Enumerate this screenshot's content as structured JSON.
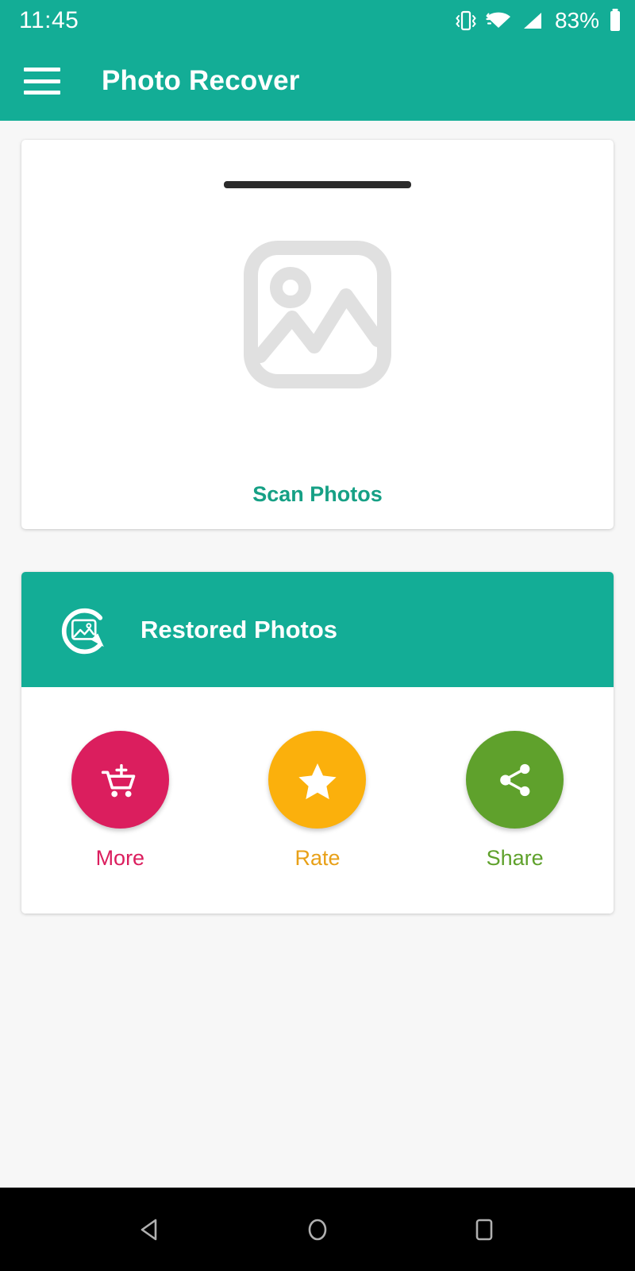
{
  "statusbar": {
    "time": "11:45",
    "battery_percent": "83%",
    "icons": [
      "vibrate-icon",
      "wifi-icon",
      "signal-icon",
      "battery-icon"
    ]
  },
  "appbar": {
    "menu_icon": "hamburger-menu-icon",
    "title": "Photo Recover",
    "background_color": "#13ad96"
  },
  "scan_card": {
    "illustration_icon": "image-placeholder-icon",
    "scan_line_color": "#2b2b2b",
    "label": "Scan Photos",
    "label_color": "#16a085"
  },
  "restored_card": {
    "header": {
      "icon": "restore-photo-icon",
      "title": "Restored Photos",
      "background_color": "#13ad96"
    },
    "actions": [
      {
        "label": "More",
        "icon": "cart-plus-icon",
        "color": "#db1e5e"
      },
      {
        "label": "Rate",
        "icon": "star-icon",
        "color": "#fbb00c"
      },
      {
        "label": "Share",
        "icon": "share-icon",
        "color": "#5fa12c"
      }
    ]
  },
  "navbar": {
    "back_label": "back-icon",
    "home_label": "home-icon",
    "recents_label": "recents-icon"
  }
}
